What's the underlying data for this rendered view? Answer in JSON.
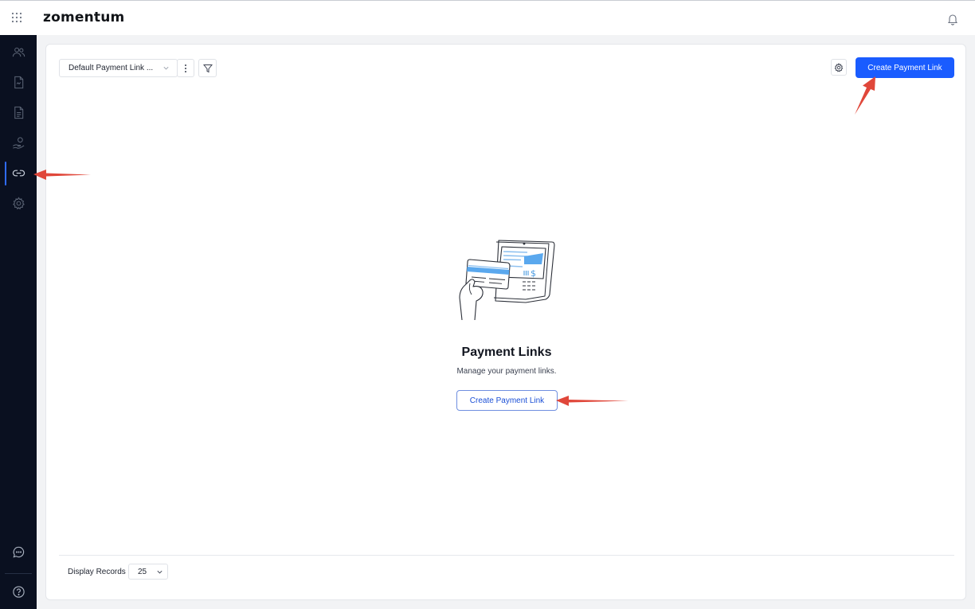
{
  "app": {
    "brand": "zomentum"
  },
  "toolbar": {
    "view_select_label": "Default Payment Link ...",
    "create_button_label": "Create Payment Link"
  },
  "empty_state": {
    "title": "Payment Links",
    "subtitle": "Manage your payment links.",
    "button_label": "Create Payment Link"
  },
  "footer": {
    "records_label": "Display Records",
    "records_value": "25"
  },
  "sidebar": {
    "items": [
      {
        "icon": "users-icon",
        "active": false
      },
      {
        "icon": "document-icon",
        "active": false
      },
      {
        "icon": "invoice-icon",
        "active": false
      },
      {
        "icon": "hand-coin-icon",
        "active": false
      },
      {
        "icon": "link-icon",
        "active": true
      },
      {
        "icon": "gear-icon",
        "active": false
      }
    ],
    "bottom_items": [
      {
        "icon": "chat-icon"
      },
      {
        "icon": "help-icon"
      }
    ]
  },
  "colors": {
    "accent": "#1a5cff",
    "sidebar_bg": "#0a1020",
    "annotation": "#e0473a"
  }
}
